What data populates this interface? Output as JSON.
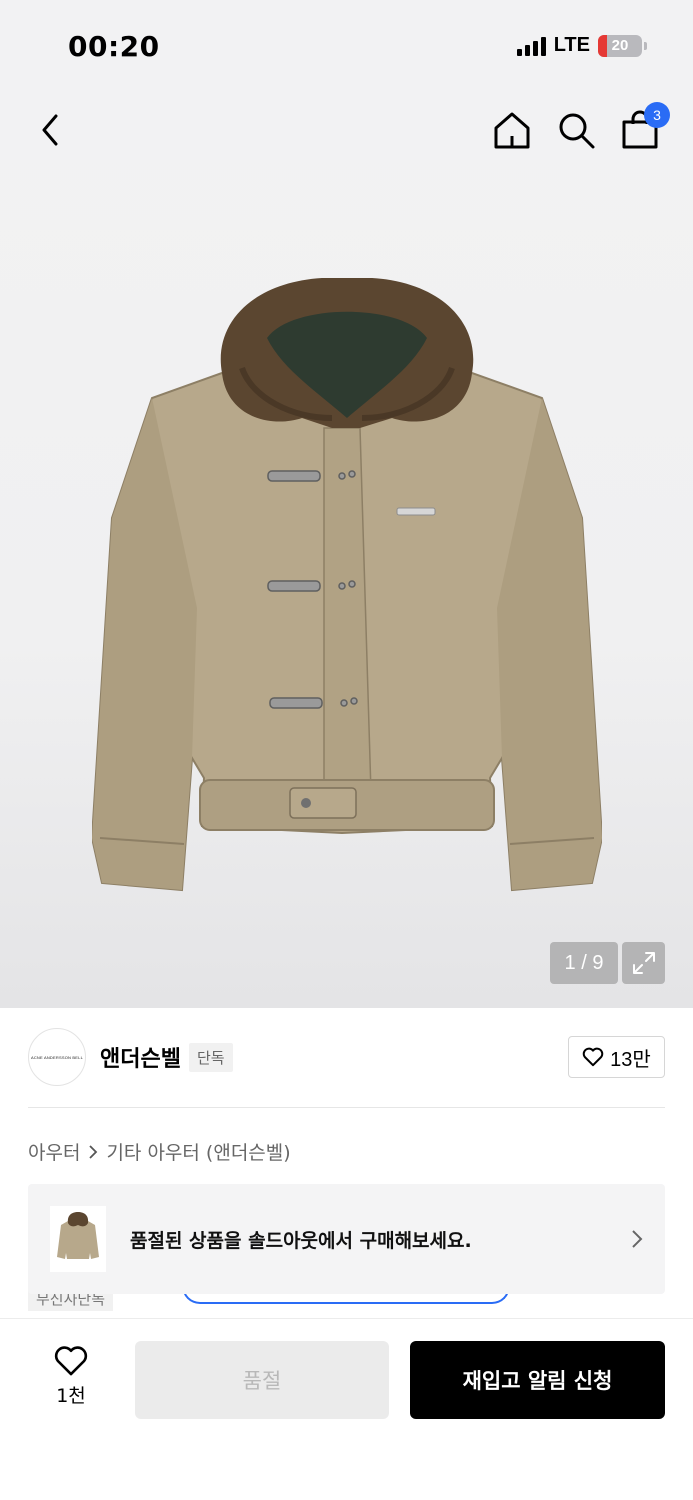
{
  "status_bar": {
    "time": "00:20",
    "network": "LTE",
    "battery": "20"
  },
  "header": {
    "cart_count": "3"
  },
  "gallery": {
    "counter": "1 / 9"
  },
  "brand": {
    "logo_text": "ACNE ANDERSSON BELL",
    "name": "앤더슨벨",
    "tag": "단독",
    "like_count": "13만"
  },
  "breadcrumb": {
    "category": "아우터",
    "subcategory": "기타 아우터 (앤더슨벨)"
  },
  "banner": {
    "text": "품절된 상품을 솔드아웃에서 구매해보세요."
  },
  "peek": {
    "tag": "무신사단독"
  },
  "bottom_bar": {
    "wish_count": "1천",
    "soldout_label": "품절",
    "restock_label": "재입고 알림 신청"
  },
  "colors": {
    "accent_blue": "#2a6cf5",
    "primary_button": "#000000",
    "disabled_button": "#ebebeb"
  }
}
